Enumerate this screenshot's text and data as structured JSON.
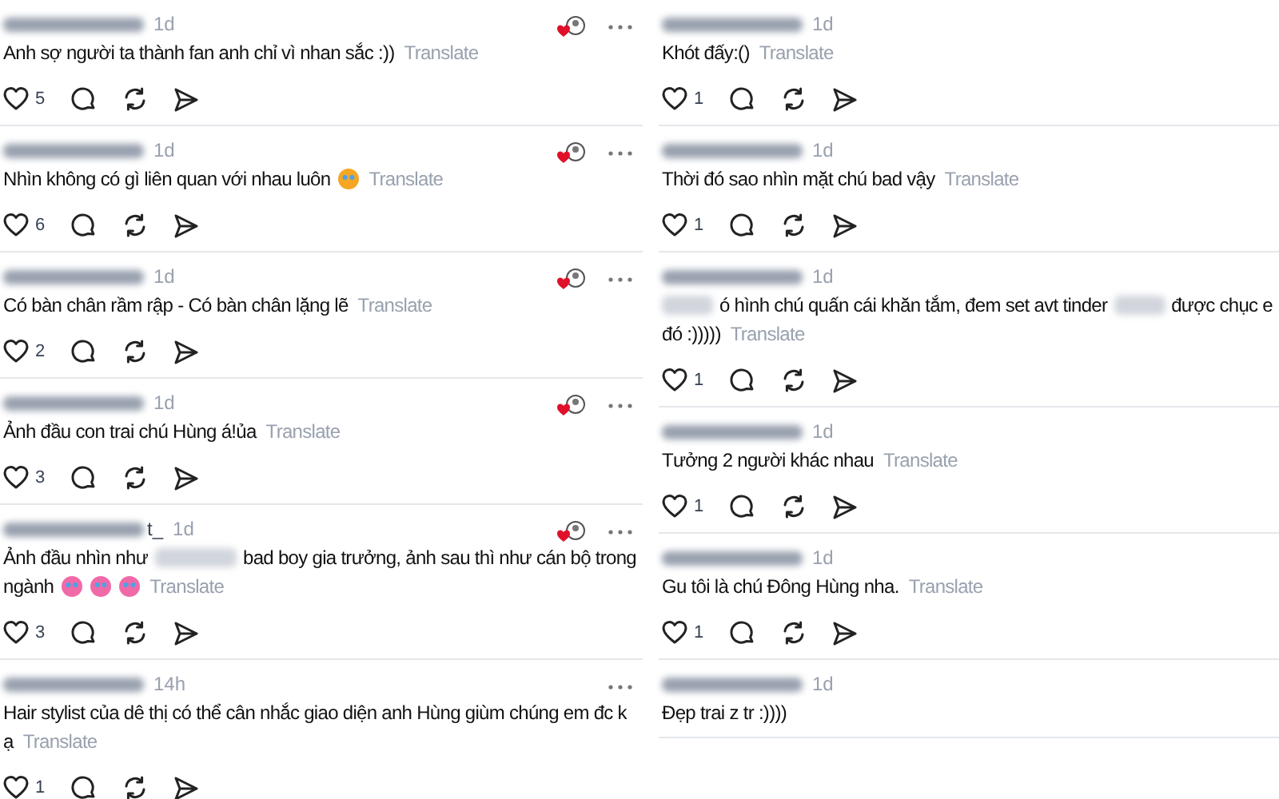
{
  "left_column": {
    "comments": [
      {
        "time": "1d",
        "body": [
          {
            "kind": "text",
            "text": "Anh sợ người ta thành fan anh chỉ vì nhan sắc :))"
          }
        ],
        "translate": "Translate",
        "likes": "5",
        "author_liked": true
      },
      {
        "time": "1d",
        "body": [
          {
            "kind": "text",
            "text": "Nhìn không có gì liên quan với nhau luôn"
          },
          {
            "kind": "emoji",
            "color": "#f5a623"
          }
        ],
        "translate": "Translate",
        "likes": "6",
        "author_liked": true
      },
      {
        "time": "1d",
        "body": [
          {
            "kind": "text",
            "text": "Có bàn chân rầm rập - Có bàn chân lặng lẽ"
          }
        ],
        "translate": "Translate",
        "likes": "2",
        "author_liked": true
      },
      {
        "time": "1d",
        "body": [
          {
            "kind": "text",
            "text": "Ảnh đầu con trai chú Hùng á!ủa"
          }
        ],
        "translate": "Translate",
        "likes": "3",
        "author_liked": true
      },
      {
        "time": "1d",
        "name_suffix": "t_",
        "body": [
          {
            "kind": "text",
            "text": "Ảnh đầu nhìn như"
          },
          {
            "kind": "blur"
          },
          {
            "kind": "text",
            "text": "bad boy gia trưởng, ảnh sau thì như cán bộ trong"
          },
          {
            "kind": "break"
          },
          {
            "kind": "text",
            "text": "ngành"
          },
          {
            "kind": "emoji",
            "color": "#f06aa8"
          },
          {
            "kind": "emoji",
            "color": "#f06aa8"
          },
          {
            "kind": "emoji",
            "color": "#f06aa8"
          }
        ],
        "translate": "Translate",
        "likes": "3",
        "author_liked": true
      },
      {
        "time": "14h",
        "body": [
          {
            "kind": "text",
            "text": "Hair stylist của dê thị có thể cân nhắc giao diện anh Hùng giùm chúng em đc k"
          },
          {
            "kind": "break"
          },
          {
            "kind": "text",
            "text": "ạ"
          }
        ],
        "translate": "Translate",
        "likes": "1",
        "author_liked": false
      }
    ]
  },
  "right_column": {
    "comments": [
      {
        "time": "1d",
        "body": [
          {
            "kind": "text",
            "text": "Khót đấy:()"
          }
        ],
        "translate": "Translate",
        "likes": "1"
      },
      {
        "time": "1d",
        "body": [
          {
            "kind": "text",
            "text": "Thời đó sao nhìn mặt chú bad vậy"
          }
        ],
        "translate": "Translate",
        "likes": "1"
      },
      {
        "time": "1d",
        "body": [
          {
            "kind": "blur"
          },
          {
            "kind": "text",
            "text": "ó hình chú quấn cái khăn tắm, đem set avt tinder"
          },
          {
            "kind": "blur"
          },
          {
            "kind": "text",
            "text": "được chục e"
          },
          {
            "kind": "break"
          },
          {
            "kind": "text",
            "text": "đó :)))))"
          }
        ],
        "translate": "Translate",
        "likes": "1"
      },
      {
        "time": "1d",
        "body": [
          {
            "kind": "text",
            "text": "Tưởng 2 người khác nhau"
          }
        ],
        "translate": "Translate",
        "likes": "1"
      },
      {
        "time": "1d",
        "body": [
          {
            "kind": "text",
            "text": "Gu tôi là chú Đông Hùng nha."
          }
        ],
        "translate": "Translate",
        "likes": "1"
      },
      {
        "time": "1d",
        "body": [
          {
            "kind": "text",
            "text": "Đẹp trai z tr :))))"
          }
        ]
      }
    ]
  }
}
